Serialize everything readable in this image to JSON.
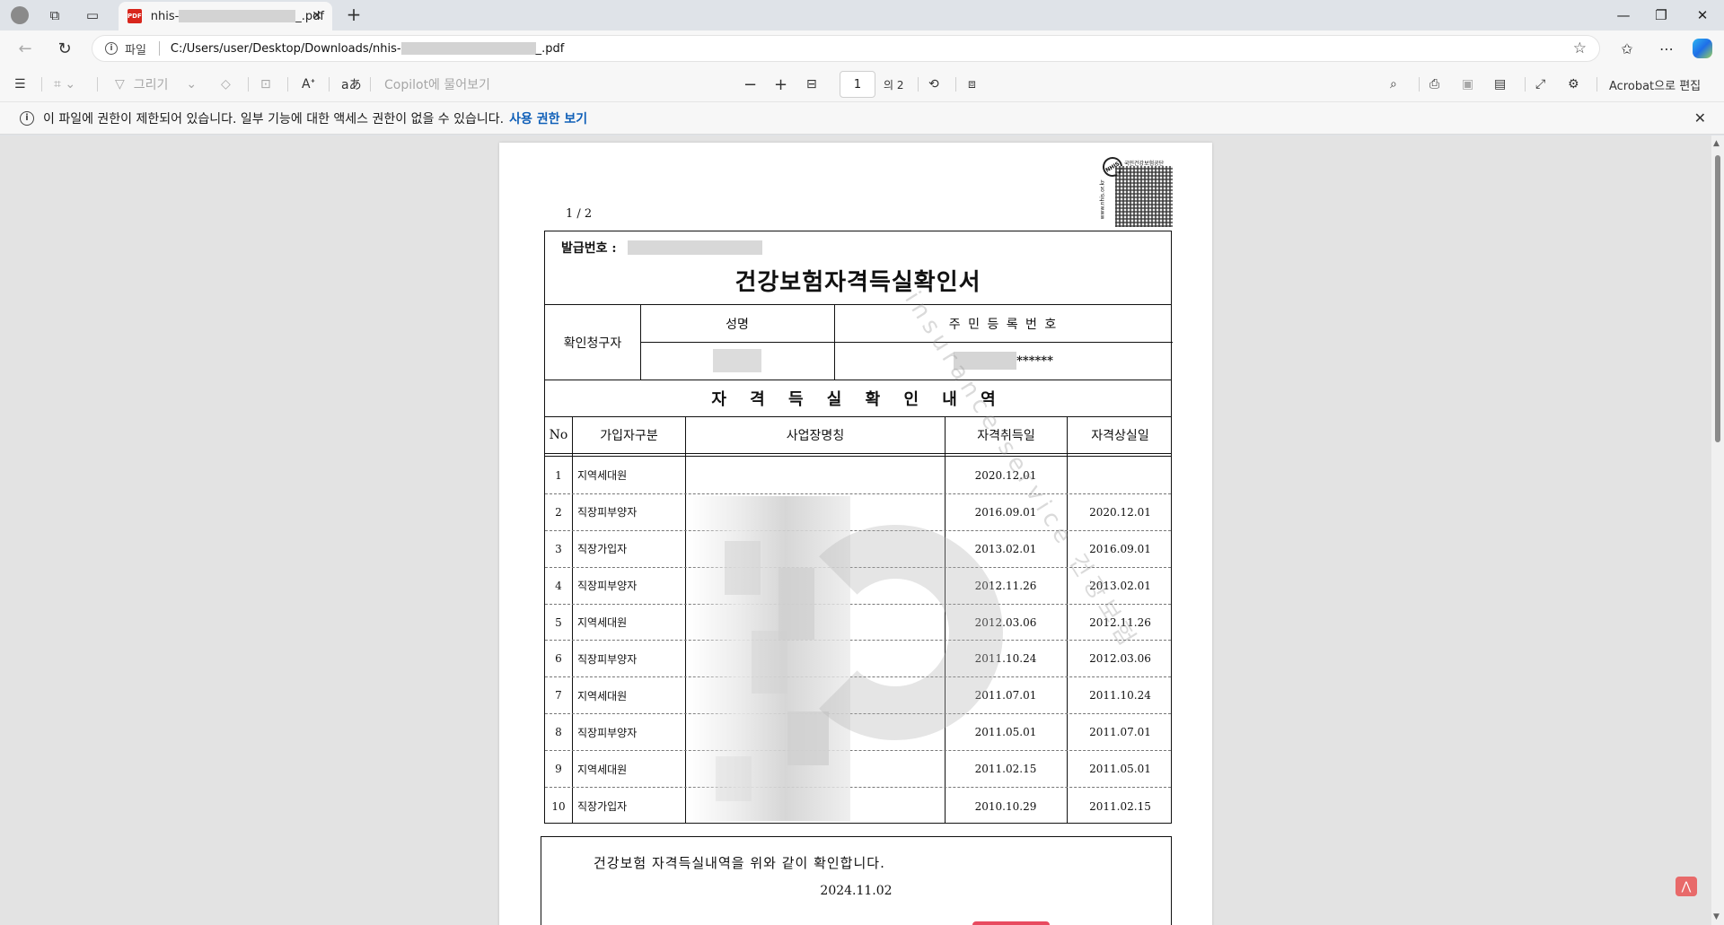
{
  "browser": {
    "tab": {
      "title_prefix": "nhis-",
      "title_suffix": "_.pdf"
    },
    "address": {
      "scheme_label": "파일",
      "url_prefix": "C:/Users/user/Desktop/Downloads/nhis-",
      "url_suffix": "_.pdf"
    }
  },
  "toolbar": {
    "draw_label": "그리기",
    "copilot_label": "Copilot에 물어보기",
    "page_current": "1",
    "page_total": "의 2",
    "acrobat_label": "Acrobat으로 편집"
  },
  "infobar": {
    "message": "이 파일에 권한이 제한되어 있습니다. 일부 기능에 대한 액세스 권한이 없을 수 있습니다.",
    "link": "사용 권한 보기"
  },
  "document": {
    "page_indicator": "1 / 2",
    "qr_org": "국민건강보험공단",
    "qr_site": "www.nhis.or.kr",
    "qr_badge": "NHIS",
    "issue_label": "발급번호 :",
    "title": "건강보험자격득실확인서",
    "requester_label": "확인청구자",
    "name_header": "성명",
    "rrn_header": "주 민 등 록 번 호",
    "rrn_mask": "******",
    "section_title": "자 격 득 실 확 인 내 역",
    "columns": [
      "No",
      "가입자구분",
      "사업장명칭",
      "자격취득일",
      "자격상실일"
    ],
    "rows": [
      {
        "no": "1",
        "type": "지역세대원",
        "acquired": "2020.12.01",
        "lost": ""
      },
      {
        "no": "2",
        "type": "직장피부양자",
        "acquired": "2016.09.01",
        "lost": "2020.12.01"
      },
      {
        "no": "3",
        "type": "직장가입자",
        "acquired": "2013.02.01",
        "lost": "2016.09.01"
      },
      {
        "no": "4",
        "type": "직장피부양자",
        "acquired": "2012.11.26",
        "lost": "2013.02.01"
      },
      {
        "no": "5",
        "type": "지역세대원",
        "acquired": "2012.03.06",
        "lost": "2012.11.26"
      },
      {
        "no": "6",
        "type": "직장피부양자",
        "acquired": "2011.10.24",
        "lost": "2012.03.06"
      },
      {
        "no": "7",
        "type": "지역세대원",
        "acquired": "2011.07.01",
        "lost": "2011.10.24"
      },
      {
        "no": "8",
        "type": "직장피부양자",
        "acquired": "2011.05.01",
        "lost": "2011.07.01"
      },
      {
        "no": "9",
        "type": "지역세대원",
        "acquired": "2011.02.15",
        "lost": "2011.05.01"
      },
      {
        "no": "10",
        "type": "직장가입자",
        "acquired": "2010.10.29",
        "lost": "2011.02.15"
      }
    ],
    "watermark": "insurance service 건강보험",
    "confirm_text": "건강보험 자격득실내역을 위와 같이 확인합니다.",
    "confirm_date": "2024.11.02"
  }
}
